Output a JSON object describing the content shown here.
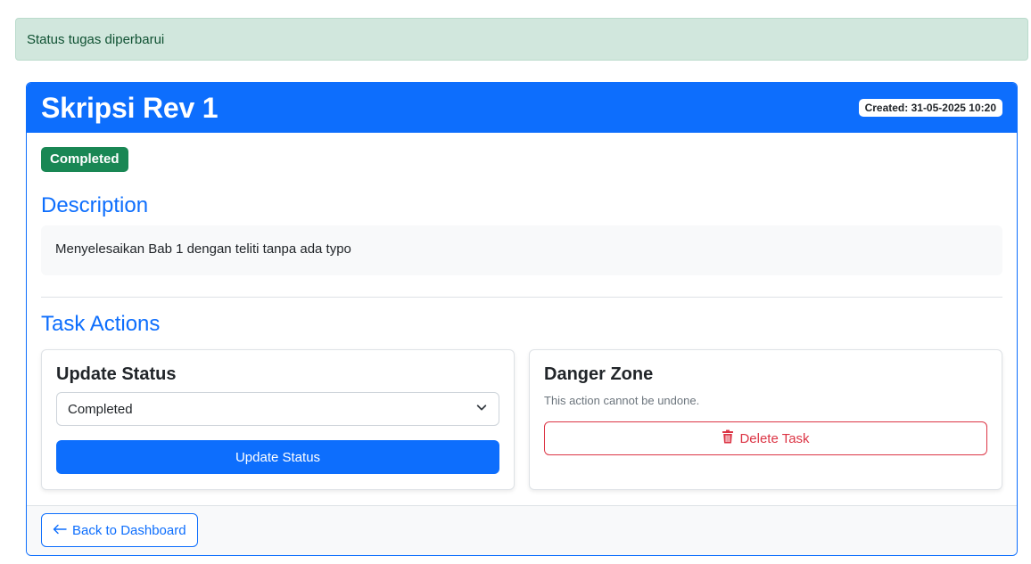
{
  "alert": {
    "message": "Status tugas diperbarui"
  },
  "task": {
    "title": "Skripsi Rev 1",
    "created_label": "Created: 31-05-2025 10:20",
    "status_badge": "Completed",
    "description_heading": "Description",
    "description_text": "Menyelesaikan Bab 1 dengan teliti tanpa ada typo"
  },
  "actions": {
    "heading": "Task Actions",
    "update": {
      "title": "Update Status",
      "selected_status": "Completed",
      "button_label": "Update Status"
    },
    "danger": {
      "title": "Danger Zone",
      "note": "This action cannot be undone.",
      "button_label": "Delete Task"
    }
  },
  "footer": {
    "back_label": "Back to Dashboard"
  },
  "colors": {
    "primary": "#0d6efd",
    "success": "#198754",
    "danger": "#dc3545",
    "alert_bg": "#d1e7dd",
    "alert_text": "#0f5132"
  },
  "icons": {
    "select_caret": "chevron-down-icon",
    "delete": "trash-icon",
    "back": "arrow-left-icon"
  }
}
